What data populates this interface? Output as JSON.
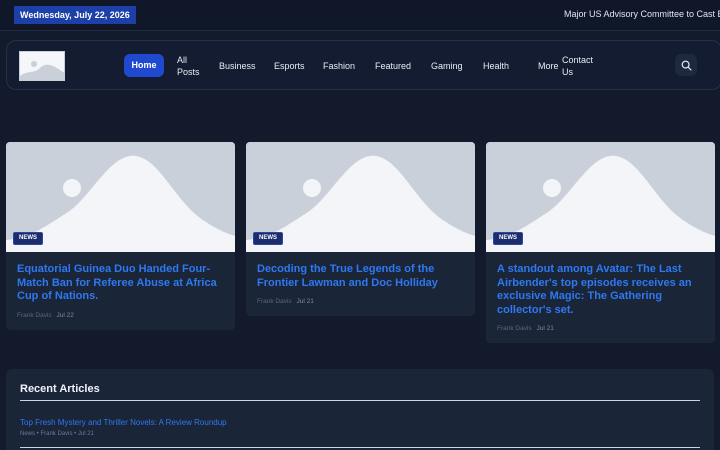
{
  "topbar": {
    "date": "Wednesday, July 22, 2026",
    "ticker": "Major US Advisory Committee to Cast Ball"
  },
  "nav": {
    "items": [
      "Home",
      "All Posts",
      "Business",
      "Esports",
      "Fashion",
      "Featured",
      "Gaming",
      "Health",
      "More",
      "Contact Us"
    ],
    "all_posts_line1": "All",
    "all_posts_line2": "Posts",
    "contact_line1": "Contact",
    "contact_line2": "Us"
  },
  "cards": [
    {
      "category": "NEWS",
      "title": "Equatorial Guinea Duo Handed Four-Match Ban for Referee Abuse at Africa Cup of Nations.",
      "author": "Frank Davis",
      "date": "Jul 22"
    },
    {
      "category": "NEWS",
      "title": "Decoding the True Legends of the Frontier Lawman and Doc Holliday",
      "author": "Frank Davis",
      "date": "Jul 21"
    },
    {
      "category": "NEWS",
      "title": "A standout among Avatar: The Last Airbender's top episodes receives an exclusive Magic: The Gathering collector's set.",
      "author": "Frank Davis",
      "date": "Jul 21"
    }
  ],
  "recent": {
    "heading": "Recent Articles",
    "articles": [
      {
        "title": "Top Fresh Mystery and Thriller Novels: A Review Roundup",
        "meta": "News • Frank Davis • Jul 21"
      }
    ]
  },
  "colors": {
    "accent": "#1f4ad0",
    "link": "#2f78f0",
    "background": "#121a2c"
  },
  "icons": {
    "search": "search-icon",
    "placeholder": "image-placeholder-icon"
  }
}
